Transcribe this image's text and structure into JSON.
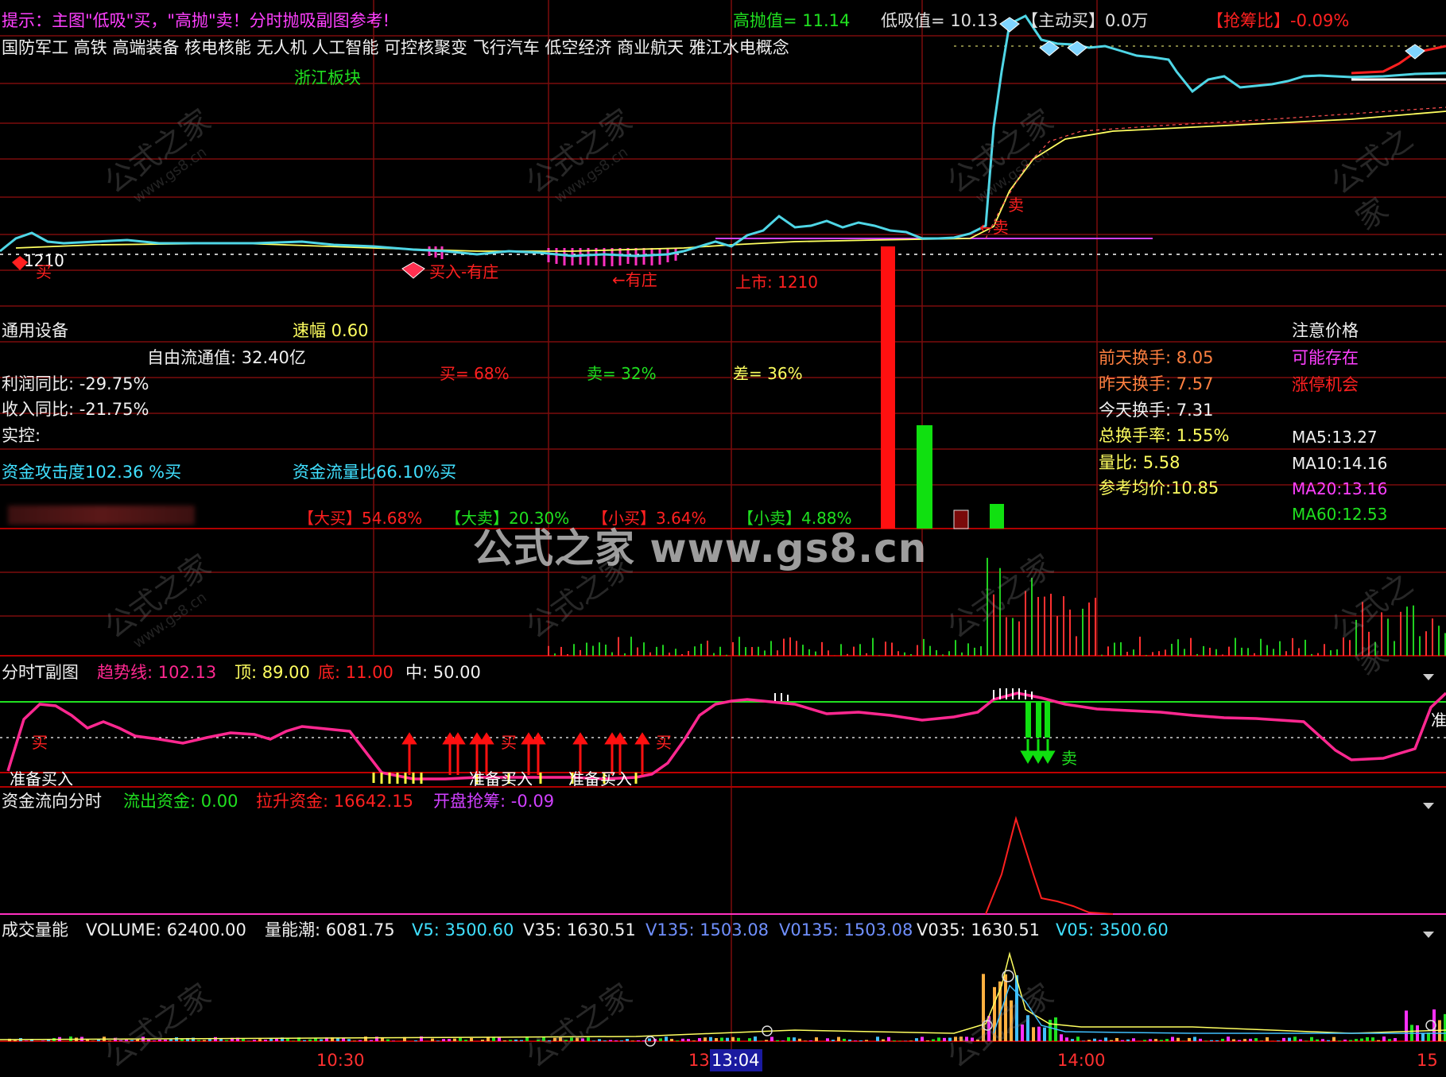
{
  "header": {
    "hint": "提示：主图\"低吸\"买，\"高抛\"卖！分时抛吸副图参考!",
    "high_sell": "高抛值= 11.14",
    "low_buy": "低吸值= 10.13",
    "active_buy": "【主动买】0.0万",
    "grab_ratio": "【抢筹比】-0.09%",
    "concepts": "国防军工 高铁 高端装备 核电核能 无人机 人工智能 可控核聚变 飞行汽车 低空经济 商业航天 雅江水电概念",
    "region": "浙江板块",
    "base_price": "1210",
    "listing": "上市: 1210",
    "buy_in_label": "买入-有庄",
    "zhuang_label": "←有庄",
    "sell_a": "卖",
    "sell_b": "←卖",
    "buy_a": "买"
  },
  "info": {
    "industry": "通用设备",
    "speed": "速幅 0.60",
    "float_value": "自由流通值: 32.40亿",
    "profit_yoy": "利润同比: -29.75%",
    "revenue_yoy": "收入同比: -21.75%",
    "controller": "实控:",
    "attack": "资金攻击度102.36 %买",
    "flow_ratio": "资金流量比66.10%买",
    "buy_pct": "买= 68%",
    "sell_pct": "卖= 32%",
    "diff_pct": "差= 36%",
    "big_buy": "【大买】54.68%",
    "big_sell": "【大卖】20.30%",
    "small_buy": "【小买】3.64%",
    "small_sell": "【小卖】4.88%",
    "turnover_before": "前天换手: 8.05",
    "turnover_yesterday": "昨天换手: 7.57",
    "turnover_today": "今天换手: 7.31",
    "turnover_total": "总换手率: 1.55%",
    "volume_ratio": "量比: 5.58",
    "ref_avg": "参考均价:10.85",
    "notice_title": "注意价格",
    "notice_1": "可能存在",
    "notice_2": "涨停机会",
    "ma5": "MA5:13.27",
    "ma10": "MA10:14.16",
    "ma20": "MA20:13.16",
    "ma60": "MA60:12.53"
  },
  "panel_t": {
    "name": "分时T副图",
    "trend": "趋势线: 102.13",
    "top": "顶: 89.00",
    "bottom": "底: 11.00",
    "mid": "中: 50.00",
    "buy_label": "买",
    "prepare_buy": "准备买入",
    "sell_label": "卖",
    "right_edge": "准"
  },
  "panel_flow": {
    "name": "资金流向分时",
    "outflow": "流出资金: 0.00",
    "lift": "拉升资金: 16642.15",
    "open_grab": "开盘抢筹: -0.09"
  },
  "panel_vol": {
    "name": "成交量能",
    "volume": "VOLUME: 62400.00",
    "tide": "量能潮: 6081.75",
    "v5": "V5: 3500.60",
    "v35": "V35: 1630.51",
    "v135": "V135: 1503.08",
    "v0135": "V0135: 1503.08",
    "v035": "V035: 1630.51",
    "v05": "V05: 3500.60"
  },
  "axis": {
    "t1": "10:30",
    "t2": "13",
    "t2_highlight": "13:04",
    "t3": "14:00",
    "t4": "15"
  },
  "watermark": {
    "big": "公式之家 www.gs8.cn",
    "small": "公式之家",
    "url": "www.gs8.cn"
  },
  "colors": {
    "grid": "#8b0000",
    "price": "#4fd6e6",
    "red": "#ff2020",
    "green": "#20e020",
    "magenta": "#ff30c0",
    "yellow": "#ffff60",
    "bg": "#000000"
  }
}
